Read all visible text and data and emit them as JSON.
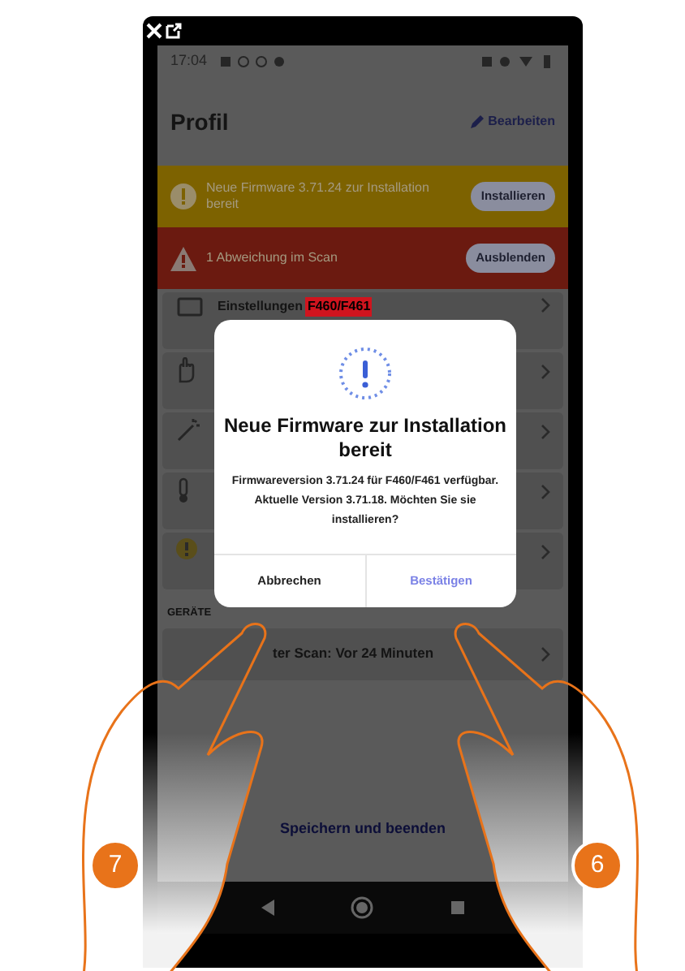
{
  "status_bar": {
    "time": "17:04"
  },
  "header": {
    "title": "Profil",
    "action": "Bearbeiten"
  },
  "banners": [
    {
      "kind": "warning",
      "text": "Neue Firmware 3.71.24 zur Installation bereit",
      "button": "Installieren"
    },
    {
      "kind": "error",
      "text": "1 Abweichung im Scan",
      "button": "Ausblenden"
    }
  ],
  "settings_rows": [
    {
      "kind": "settings",
      "label": "Einstellungen",
      "tag": "F460/F461"
    },
    {
      "kind": "hand"
    },
    {
      "kind": "wand"
    },
    {
      "kind": "thermometer"
    },
    {
      "kind": "alert"
    }
  ],
  "devices": {
    "heading": "GERÄTE",
    "rows": [
      {
        "text": "ter Scan: Vor 24 Minuten"
      }
    ]
  },
  "save_button": "Speichern und beenden",
  "dialog": {
    "title": "Neue Firmware zur Installation bereit",
    "message": "Firmwareversion 3.71.24 für F460/F461 verfügbar. Aktuelle Version 3.71.18. Möchten Sie sie installieren?",
    "buttons": [
      {
        "kind": "cancel",
        "label": "Abbrechen"
      },
      {
        "kind": "confirm",
        "label": "Bestätigen"
      }
    ]
  },
  "callouts": [
    {
      "number": "7"
    },
    {
      "number": "6"
    }
  ]
}
